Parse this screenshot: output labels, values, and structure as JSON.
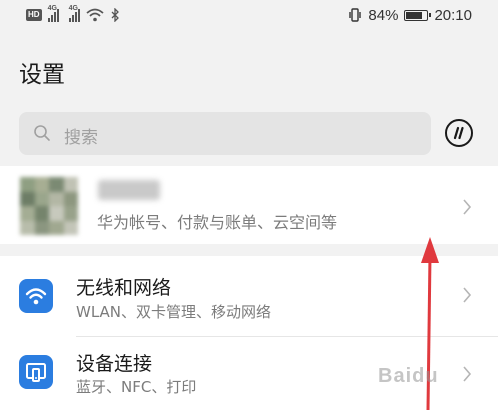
{
  "status_bar": {
    "hd_label": "HD",
    "network_1": "4G",
    "network_2": "4G",
    "battery_percent": "84%",
    "battery_level": 0.84,
    "time": "20:10",
    "icons": [
      "hd-icon",
      "signal-icon",
      "signal-icon",
      "wifi-icon",
      "bluetooth-icon",
      "vibrate-icon",
      "battery-icon"
    ]
  },
  "header": {
    "title": "设置"
  },
  "search": {
    "placeholder": "搜索",
    "icon": "search-icon",
    "side_button_icon": "pause-circle-icon"
  },
  "account": {
    "subtitle": "华为帐号、付款与账单、云空间等",
    "avatar_colors": [
      "#8f9f82",
      "#a7ae93",
      "#7b8a73",
      "#c0c2b4",
      "#6d7d66",
      "#9aa68c",
      "#b3b7a5",
      "#8d977f",
      "#a4ad94",
      "#75846c",
      "#c7c9bd",
      "#98a28a",
      "#b8bdab",
      "#8b9680",
      "#a0a890",
      "#c3c5b8"
    ]
  },
  "settings": {
    "items": [
      {
        "title": "无线和网络",
        "subtitle": "WLAN、双卡管理、移动网络",
        "icon": "wifi-icon"
      },
      {
        "title": "设备连接",
        "subtitle": "蓝牙、NFC、打印",
        "icon": "device-connect-icon"
      }
    ]
  },
  "annotation": {
    "color": "#e0393e"
  },
  "watermark": {
    "text": "Baidu"
  },
  "colors": {
    "accent": "#2b7de0",
    "background": "#f2f2f2"
  }
}
